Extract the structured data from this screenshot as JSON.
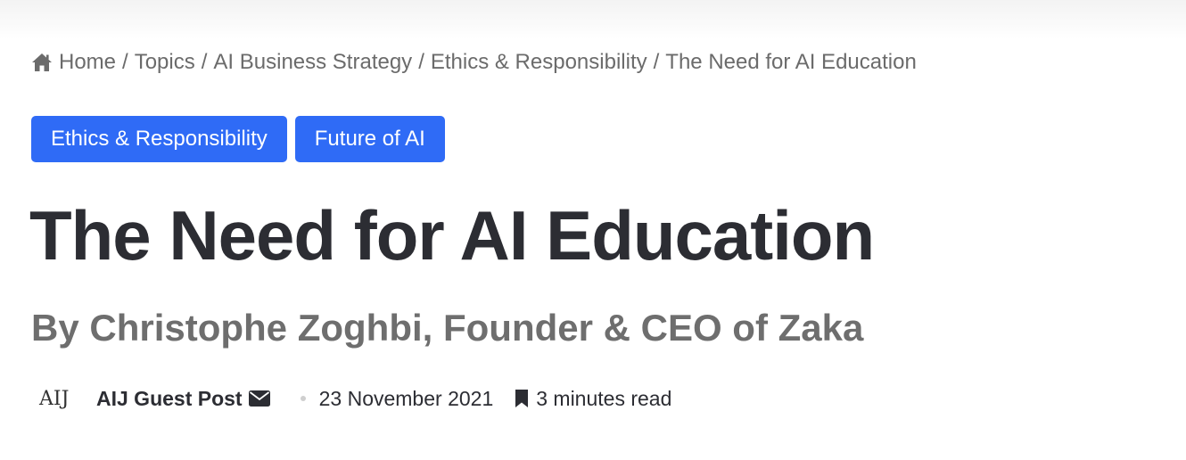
{
  "breadcrumb": {
    "home_icon": "home-icon",
    "items": [
      "Home",
      "Topics",
      "AI Business Strategy",
      "Ethics & Responsibility",
      "The Need for AI Education"
    ],
    "separator": "/"
  },
  "tags": [
    "Ethics & Responsibility",
    "Future of AI"
  ],
  "tag_color": "#2f6bf6",
  "article": {
    "title": "The Need for AI Education",
    "subtitle": "By Christophe Zoghbi, Founder & CEO of Zaka"
  },
  "meta": {
    "avatar_text": "AIJ",
    "author": "AIJ Guest Post",
    "mail_icon": "envelope-icon",
    "date": "23 November 2021",
    "reading_icon": "bookmark-icon",
    "reading_time": "3 minutes read"
  }
}
